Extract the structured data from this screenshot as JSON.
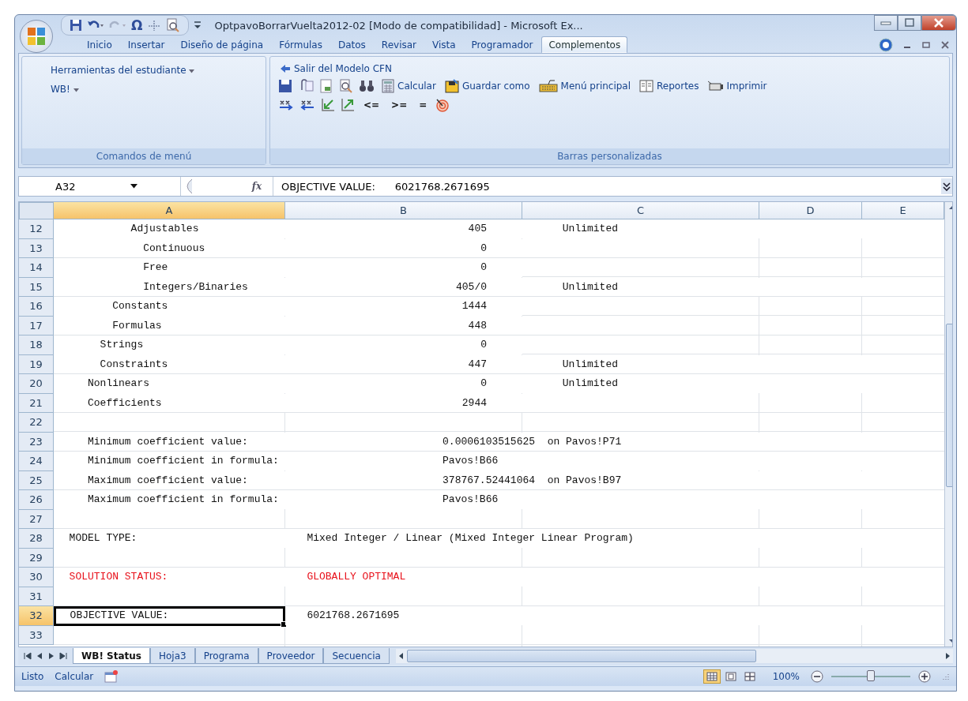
{
  "window": {
    "title": "OptpavoBorrarVuelta2012-02  [Modo de compatibilidad] - Microsoft Ex..."
  },
  "quick_access": {
    "symbol": "Ω"
  },
  "ribbon_tabs": [
    {
      "label": "Inicio",
      "selected": false
    },
    {
      "label": "Insertar",
      "selected": false
    },
    {
      "label": "Diseño de página",
      "selected": false
    },
    {
      "label": "Fórmulas",
      "selected": false
    },
    {
      "label": "Datos",
      "selected": false
    },
    {
      "label": "Revisar",
      "selected": false
    },
    {
      "label": "Vista",
      "selected": false
    },
    {
      "label": "Programador",
      "selected": false
    },
    {
      "label": "Complementos",
      "selected": true
    }
  ],
  "groups": [
    {
      "label": "Comandos de menú",
      "menus": [
        "Herramientas del estudiante",
        "WB!"
      ]
    },
    {
      "label": "Barras personalizadas",
      "exit_button": "Salir del Modelo CFN",
      "buttons": [
        "Calcular",
        "Guardar como",
        "Menú principal",
        "Reportes",
        "Imprimir"
      ],
      "operators": [
        "<=",
        ">=",
        "="
      ]
    }
  ],
  "formula_bar": {
    "name_box": "A32",
    "fx": "fx",
    "formula": "OBJECTIVE VALUE:      6021768.2671695"
  },
  "columns": [
    {
      "label": "A",
      "selected": true
    },
    {
      "label": "B",
      "selected": false
    },
    {
      "label": "C",
      "selected": false
    },
    {
      "label": "D",
      "selected": false
    },
    {
      "label": "E",
      "selected": false
    }
  ],
  "rows": [
    {
      "number": "12",
      "selected": false,
      "kind": "count",
      "a": "            Adjustables",
      "b": "405",
      "c": "      Unlimited"
    },
    {
      "number": "13",
      "selected": false,
      "kind": "count",
      "a": "              Continuous",
      "b": "0"
    },
    {
      "number": "14",
      "selected": false,
      "kind": "count",
      "a": "              Free",
      "b": "0"
    },
    {
      "number": "15",
      "selected": false,
      "kind": "count",
      "a": "              Integers/Binaries",
      "b": "405/0",
      "c": "      Unlimited"
    },
    {
      "number": "16",
      "selected": false,
      "kind": "count",
      "a": "         Constants",
      "b": "1444"
    },
    {
      "number": "17",
      "selected": false,
      "kind": "count",
      "a": "         Formulas",
      "b": "448"
    },
    {
      "number": "18",
      "selected": false,
      "kind": "count",
      "a": "       Strings",
      "b": "0"
    },
    {
      "number": "19",
      "selected": false,
      "kind": "count",
      "a": "       Constraints",
      "b": "447",
      "c": "      Unlimited"
    },
    {
      "number": "20",
      "selected": false,
      "kind": "count",
      "a": "     Nonlinears",
      "b": "0",
      "c": "      Unlimited"
    },
    {
      "number": "21",
      "selected": false,
      "kind": "count",
      "a": "     Coefficients",
      "b": "2944"
    },
    {
      "number": "22",
      "selected": false
    },
    {
      "number": "23",
      "selected": false,
      "kind": "text",
      "a": "     Minimum coefficient value:",
      "b": "                         0.0006103515625  on Pavos!P71"
    },
    {
      "number": "24",
      "selected": false,
      "kind": "text",
      "a": "     Minimum coefficient in formula:",
      "b": "                         Pavos!B66"
    },
    {
      "number": "25",
      "selected": false,
      "kind": "text",
      "a": "     Maximum coefficient value:",
      "b": "                         378767.52441064  on Pavos!B97"
    },
    {
      "number": "26",
      "selected": false,
      "kind": "text",
      "a": "     Maximum coefficient in formula:",
      "b": "                         Pavos!B66"
    },
    {
      "number": "27",
      "selected": false
    },
    {
      "number": "28",
      "selected": false,
      "kind": "text",
      "a": "  MODEL TYPE:",
      "b": "   Mixed Integer / Linear (Mixed Integer Linear Program)"
    },
    {
      "number": "29",
      "selected": false
    },
    {
      "number": "30",
      "selected": false,
      "kind": "text",
      "flagged": true,
      "a": "  SOLUTION STATUS:",
      "b": "   GLOBALLY OPTIMAL"
    },
    {
      "number": "31",
      "selected": false
    },
    {
      "number": "32",
      "selected": true,
      "kind": "text",
      "a": "  OBJECTIVE VALUE:",
      "b": "   6021768.2671695"
    },
    {
      "number": "33",
      "selected": false
    }
  ],
  "sheet_tabs": [
    {
      "label": "WB! Status",
      "selected": true
    },
    {
      "label": "Hoja3",
      "selected": false
    },
    {
      "label": "Programa",
      "selected": false
    },
    {
      "label": "Proveedor",
      "selected": false
    },
    {
      "label": "Secuencia",
      "selected": false
    }
  ],
  "status_bar": {
    "mode": "Listo",
    "calc": "Calcular",
    "views": [
      {
        "selected": true
      },
      {
        "selected": false
      },
      {
        "selected": false
      }
    ],
    "zoom": "100%",
    "zoom_slider": {
      "level": 0.5
    }
  }
}
